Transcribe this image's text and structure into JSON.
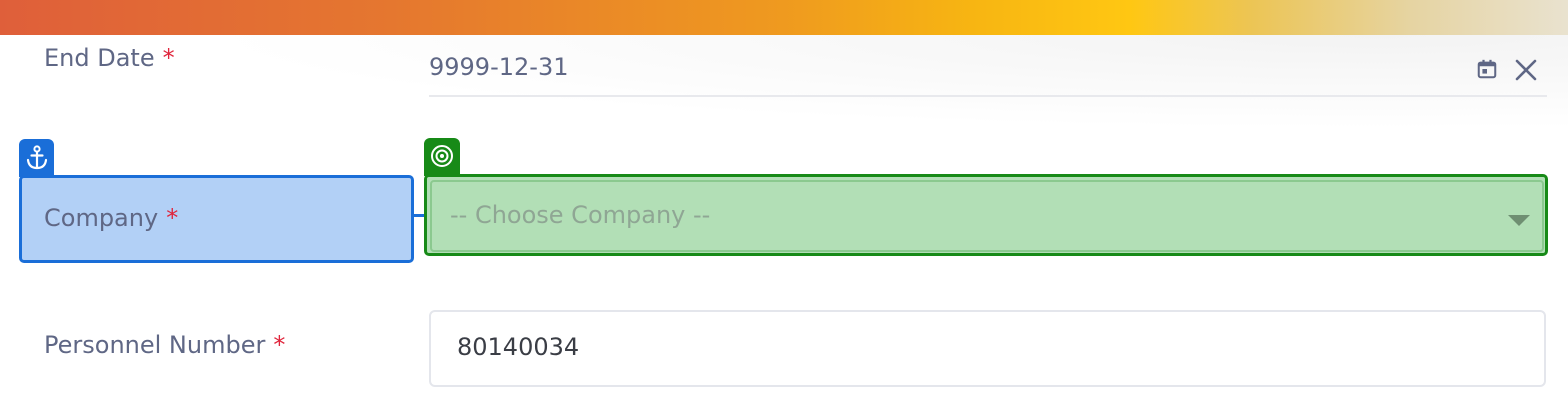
{
  "form": {
    "end_date": {
      "label": "End Date",
      "required_mark": "*",
      "value": "9999-12-31",
      "icons": [
        "calendar-icon",
        "close-icon"
      ]
    },
    "company": {
      "label": "Company",
      "required_mark": "*",
      "placeholder": "-- Choose Company --",
      "icons": [
        "anchor-icon",
        "target-icon",
        "caret-down-icon"
      ]
    },
    "personnel_number": {
      "label": "Personnel Number",
      "required_mark": "*",
      "value": "80140034"
    }
  },
  "colors": {
    "anchor_highlight": "#1a6ed8",
    "target_highlight": "#178a17",
    "required": "#e0253c"
  }
}
